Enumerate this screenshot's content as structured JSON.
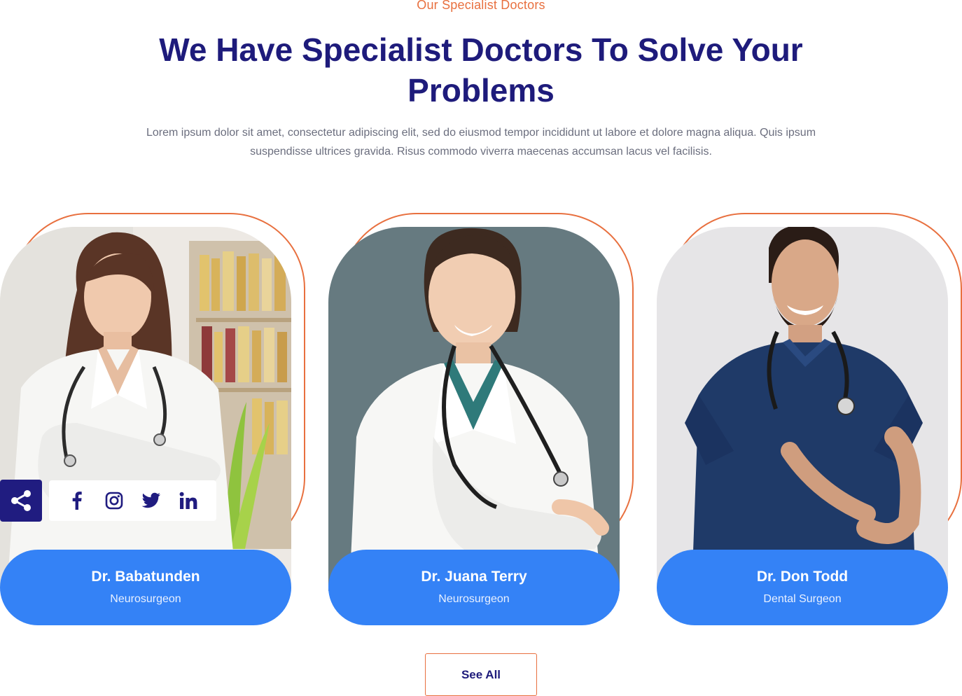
{
  "section": {
    "eyebrow": "Our Specialist Doctors",
    "title": "We Have Specialist Doctors To Solve Your Problems",
    "description": "Lorem ipsum dolor sit amet, consectetur adipiscing elit, sed do eiusmod tempor incididunt ut labore et dolore magna aliqua. Quis ipsum suspendisse ultrices gravida. Risus commodo viverra maecenas accumsan lacus vel facilisis."
  },
  "doctors": [
    {
      "name": "Dr. Babatunden",
      "role": "Neurosurgeon",
      "photo": "female-doctor-bookshelf-photo"
    },
    {
      "name": "Dr. Juana Terry",
      "role": "Neurosurgeon",
      "photo": "female-doctor-grey-background-photo"
    },
    {
      "name": "Dr. Don Todd",
      "role": "Dental Surgeon",
      "photo": "male-doctor-navy-scrubs-photo"
    }
  ],
  "social": {
    "share_icon": "share-icon",
    "icons": [
      "facebook-icon",
      "instagram-icon",
      "twitter-icon",
      "linkedin-icon"
    ]
  },
  "cta": {
    "see_all_label": "See All"
  },
  "colors": {
    "accent_orange": "#e8703f",
    "navy": "#1e1b7b",
    "plate_blue": "#3482f6",
    "share_navy": "#201c80",
    "body_text": "#6b6e7e"
  }
}
